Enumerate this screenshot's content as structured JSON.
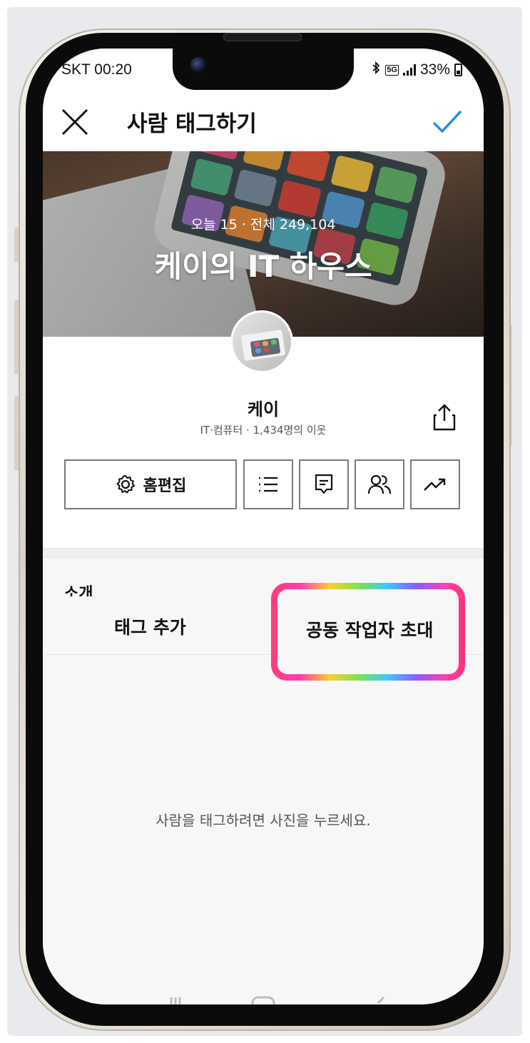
{
  "status_bar": {
    "carrier_time": "SKT 00:20",
    "network": "5G",
    "battery": "33%"
  },
  "header": {
    "title": "사람 태그하기"
  },
  "cover": {
    "stats": "오늘 15 · 전체 249,104",
    "title": "케이의 IT 하우스"
  },
  "profile": {
    "name": "케이",
    "meta": "IT·컴퓨터 · 1,434명의 이웃",
    "edit_button": "홈편집"
  },
  "intro_peek": "소개",
  "sheet": {
    "tabs": [
      "태그 추가",
      "공동 작업자 초대"
    ],
    "hint": "사람을 태그하려면 사진을 누르세요."
  },
  "colors": {
    "accent_check": "#2b8ce6",
    "highlight_gradient": [
      "#ff3b7a",
      "#ffcc33",
      "#7ce34f",
      "#3fc9ff",
      "#8a5cff"
    ]
  }
}
